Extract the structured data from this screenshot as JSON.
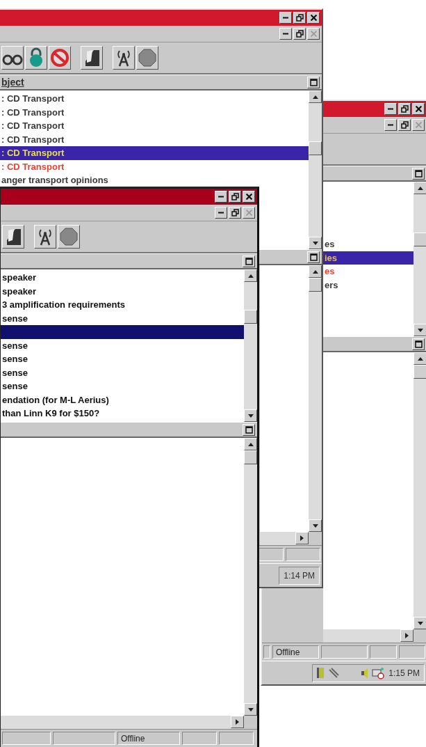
{
  "windows": [
    {
      "focused": false,
      "header": "bject",
      "list": [
        {
          "label": ": CD Transport",
          "selected": false,
          "color": "#3a3a3a"
        },
        {
          "label": ": CD Transport",
          "selected": false,
          "color": "#3a3a3a"
        },
        {
          "label": ": CD Transport",
          "selected": false,
          "color": "#3a3a3a"
        },
        {
          "label": ": CD Transport",
          "selected": false,
          "color": "#3a3a3a"
        },
        {
          "label": ": CD Transport",
          "selected": true,
          "color": "#e8e040"
        },
        {
          "label": ": CD Transport",
          "selected": false,
          "color": "#f04030"
        },
        {
          "label": "anger transport opinions",
          "selected": false,
          "color": "#3a3a3a"
        }
      ],
      "taskbar": {
        "clock": "1:14 PM"
      }
    },
    {
      "focused": false,
      "list": [
        {
          "label": "es",
          "selected": false,
          "color": "#3a3a3a"
        },
        {
          "label": "ies",
          "selected": true,
          "color": "#e8c040"
        },
        {
          "label": "es",
          "selected": false,
          "color": "#f04030"
        },
        {
          "label": "ers",
          "selected": false,
          "color": "#3a3a3a"
        }
      ],
      "status_bar": {
        "text": "Offline"
      },
      "taskbar": {
        "clock": "1:15 PM"
      }
    },
    {
      "focused": true,
      "list": [
        {
          "label": "speaker",
          "selected": false,
          "color": "#101010"
        },
        {
          "label": "speaker",
          "selected": false,
          "color": "#101010"
        },
        {
          "label": "3 amplification requirements",
          "selected": false,
          "color": "#101010"
        },
        {
          "label": "sense",
          "selected": false,
          "color": "#101010"
        },
        {
          "selected": true
        },
        {
          "label": "sense",
          "selected": false,
          "color": "#101010"
        },
        {
          "label": "sense",
          "selected": false,
          "color": "#101010"
        },
        {
          "label": "sense",
          "selected": false,
          "color": "#101010"
        },
        {
          "label": "sense",
          "selected": false,
          "color": "#101010"
        },
        {
          "label": "endation (for M-L Aerius)",
          "selected": false,
          "color": "#101010"
        },
        {
          "label": "than Linn K9 for $150?",
          "selected": false,
          "color": "#101010"
        }
      ],
      "status_bar": {
        "text": "Offline"
      }
    }
  ]
}
